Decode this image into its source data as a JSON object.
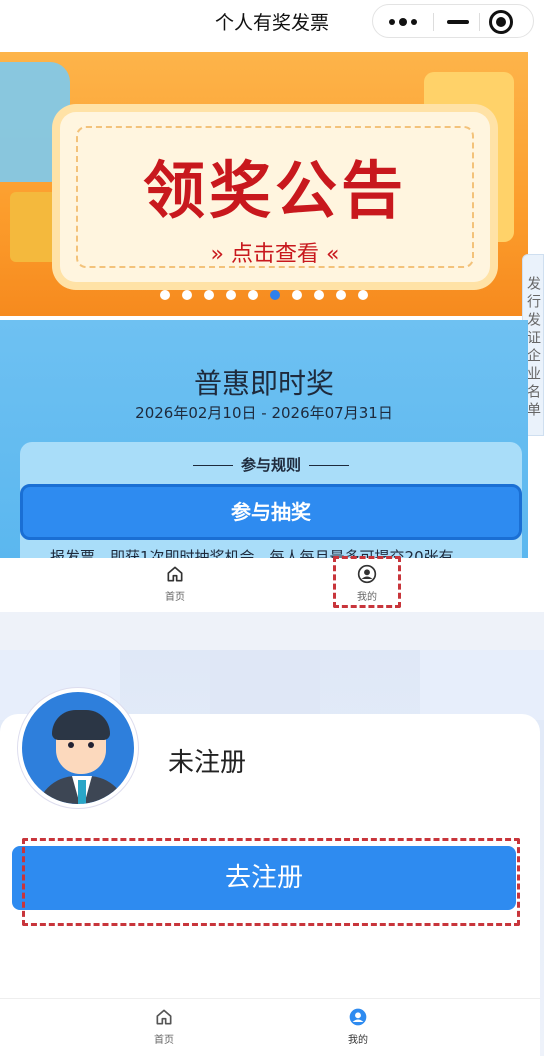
{
  "top_screen": {
    "nav": {
      "title": "个人有奖发票",
      "capsule_icons": [
        "more-icon",
        "minimize-icon",
        "close-icon"
      ]
    },
    "banner": {
      "title": "领奖公告",
      "subtitle": "» 点击查看 «",
      "dot_count": 10,
      "active_dot": 6
    },
    "side_tab": "发行发证企业名单",
    "promo": {
      "title": "普惠即时奖",
      "date_range": "2026年02月10日 - 2026年07月31日",
      "rules_heading": "参与规则",
      "rules_text": "报发票，即获1次即时抽奖机会，每人每月最多可提交20张有",
      "draw_button": "参与抽奖"
    },
    "tabbar": [
      {
        "label": "首页",
        "icon": "home-icon"
      },
      {
        "label": "我的",
        "icon": "user-icon"
      }
    ]
  },
  "bottom_screen": {
    "status": "未注册",
    "register_button": "去注册",
    "tabbar": [
      {
        "label": "首页",
        "icon": "home-icon"
      },
      {
        "label": "我的",
        "icon": "user-icon"
      }
    ]
  },
  "colors": {
    "primary": "#2e8bf0",
    "highlight_border": "#c8353b",
    "banner_red": "#c8181d",
    "promo_bg": "#6ec1f2"
  }
}
